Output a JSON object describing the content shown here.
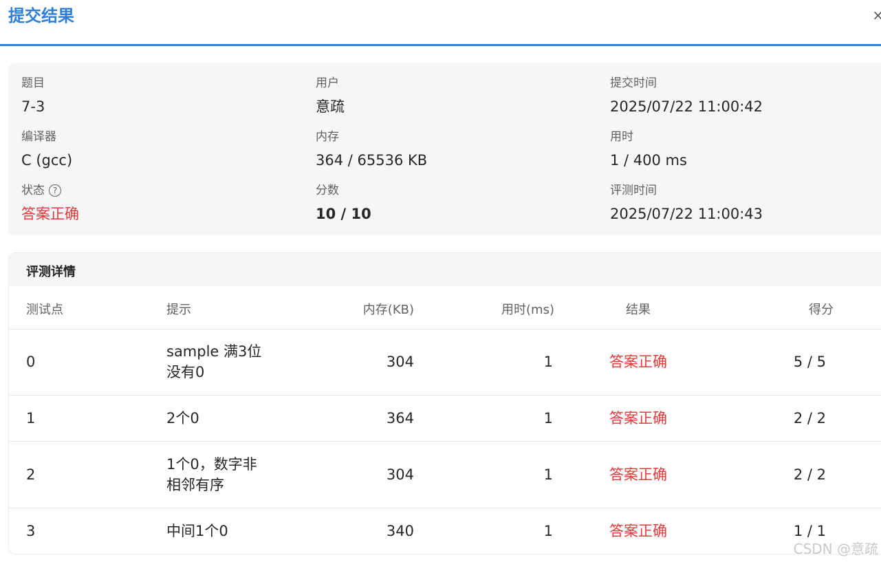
{
  "header": {
    "title": "提交结果",
    "close_glyph": "×"
  },
  "summary": {
    "problem_label": "题目",
    "problem_value": "7-3",
    "user_label": "用户",
    "user_value": "意疏",
    "submit_time_label": "提交时间",
    "submit_time_value": "2025/07/22 11:00:42",
    "compiler_label": "编译器",
    "compiler_value": "C (gcc)",
    "memory_label": "内存",
    "memory_value": "364 / 65536 KB",
    "time_label": "用时",
    "time_value": "1 / 400 ms",
    "status_label": "状态",
    "status_value": "答案正确",
    "score_label": "分数",
    "score_value": "10 / 10",
    "judge_time_label": "评测时间",
    "judge_time_value": "2025/07/22 11:00:43"
  },
  "detail": {
    "title": "评测详情",
    "columns": [
      "测试点",
      "提示",
      "内存(KB)",
      "用时(ms)",
      "结果",
      "得分"
    ],
    "rows": [
      {
        "id": "0",
        "hint_line1": "sample 满3位",
        "hint_line2": "没有0",
        "memory": "304",
        "time": "1",
        "result": "答案正确",
        "score": "5 / 5"
      },
      {
        "id": "1",
        "hint_line1": "2个0",
        "hint_line2": "",
        "memory": "364",
        "time": "1",
        "result": "答案正确",
        "score": "2 / 2"
      },
      {
        "id": "2",
        "hint_line1": "1个0，数字非",
        "hint_line2": "相邻有序",
        "memory": "304",
        "time": "1",
        "result": "答案正确",
        "score": "2 / 2"
      },
      {
        "id": "3",
        "hint_line1": "中间1个0",
        "hint_line2": "",
        "memory": "340",
        "time": "1",
        "result": "答案正确",
        "score": "1 / 1"
      }
    ]
  },
  "watermark": "CSDN @意疏",
  "colors": {
    "accent": "#2f7fd9",
    "success": "#e8383a",
    "panel": "#f5f6f8"
  }
}
